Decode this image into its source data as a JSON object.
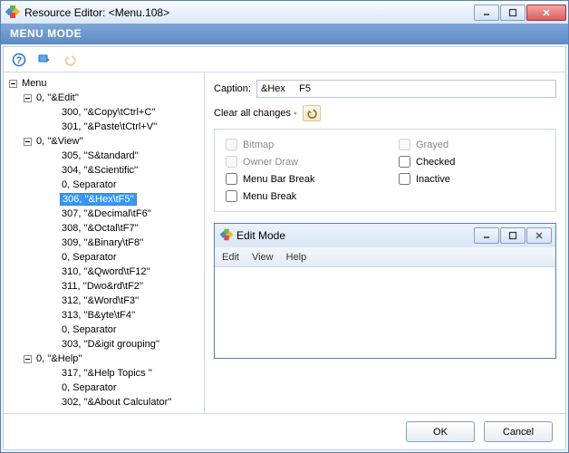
{
  "window": {
    "title": "Resource Editor: <Menu.108>"
  },
  "header": "MENU MODE",
  "toolbar": {
    "help": "help-icon",
    "refresh": "refresh-icon",
    "undo": "undo-icon"
  },
  "tree": {
    "root": "Menu",
    "groups": [
      {
        "label": "0, ''&Edit''",
        "children": [
          "300, ''&Copy\\tCtrl+C''",
          "301, ''&Paste\\tCtrl+V''"
        ]
      },
      {
        "label": "0, ''&View''",
        "children": [
          "305, ''S&tandard''",
          "304, ''&Scientific''",
          "0, Separator",
          "306, ''&Hex\\tF5''",
          "307, ''&Decimal\\tF6''",
          "308, ''&Octal\\tF7''",
          "309, ''&Binary\\tF8''",
          "0, Separator",
          "310, ''&Qword\\tF12''",
          "311, ''Dwo&rd\\tF2''",
          "312, ''&Word\\tF3''",
          "313, ''B&yte\\tF4''",
          "0, Separator",
          "303, ''D&igit grouping''"
        ],
        "selected_index": 3
      },
      {
        "label": "0, ''&Help''",
        "children": [
          "317, ''&Help Topics ''",
          "0, Separator",
          "302, ''&About Calculator''"
        ]
      }
    ]
  },
  "panel": {
    "caption_label": "Caption:",
    "caption_value": "&Hex     F5",
    "clear_label": "Clear all changes -",
    "checks": {
      "bitmap": "Bitmap",
      "owner_draw": "Owner Draw",
      "menu_bar_break": "Menu Bar Break",
      "menu_break": "Menu Break",
      "grayed": "Grayed",
      "checked": "Checked",
      "inactive": "Inactive"
    }
  },
  "inner": {
    "title": "Edit Mode",
    "menu": [
      "Edit",
      "View",
      "Help"
    ]
  },
  "footer": {
    "ok": "OK",
    "cancel": "Cancel"
  }
}
